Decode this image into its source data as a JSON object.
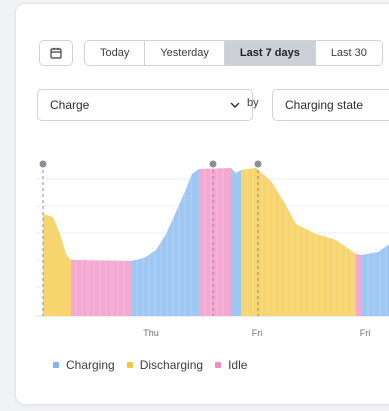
{
  "toolbar": {
    "calendar_icon": "calendar-icon",
    "ranges": [
      {
        "label": "Today",
        "active": false
      },
      {
        "label": "Yesterday",
        "active": false
      },
      {
        "label": "Last 7 days",
        "active": true
      },
      {
        "label": "Last 30",
        "active": false
      }
    ]
  },
  "filters": {
    "metric": "Charge",
    "by_label": "by",
    "group_by": "Charging state",
    "chevron_icon": "chevron-down-icon"
  },
  "chart_data": {
    "type": "area",
    "x_ticks": [
      "Thu",
      "Fri",
      "Fri"
    ],
    "legend": [
      {
        "name": "Charging",
        "color": "#9ec7f2"
      },
      {
        "name": "Discharging",
        "color": "#f7d56e"
      },
      {
        "name": "Idle",
        "color": "#f4a9d2"
      }
    ],
    "markers": 3,
    "series": [
      {
        "name": "Discharging",
        "values": [
          0.78,
          0.76,
          0.38
        ]
      },
      {
        "name": "Idle",
        "values": [
          0.38,
          0.38,
          0.38
        ]
      },
      {
        "name": "Charging",
        "values": [
          0.38,
          0.45,
          0.78,
          0.95
        ]
      },
      {
        "name": "Idle",
        "values": [
          0.96,
          0.96
        ]
      },
      {
        "name": "Discharging",
        "values": [
          0.95,
          0.9,
          0.62,
          0.55,
          0.45
        ]
      },
      {
        "name": "Charging",
        "values": [
          0.45,
          0.5
        ]
      }
    ]
  }
}
